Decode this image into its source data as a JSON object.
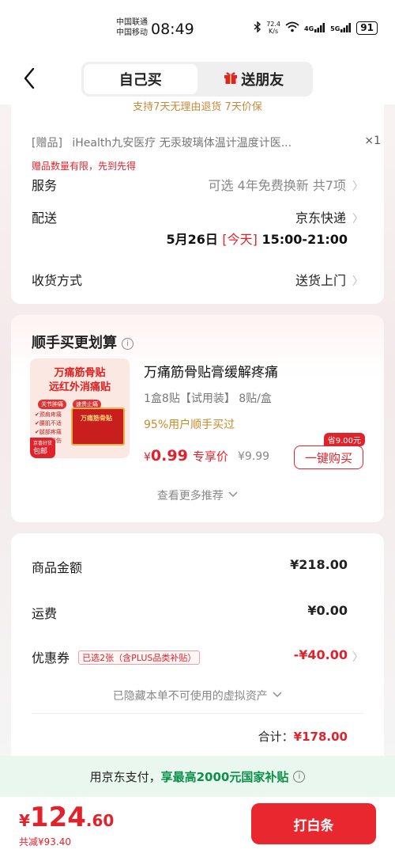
{
  "status_bar": {
    "carrier1": "中国联通",
    "carrier2": "中国移动",
    "time": "08:49",
    "net_speed": "72.4",
    "net_unit": "K/s",
    "signal1": "4G",
    "signal2": "5G",
    "battery": "91"
  },
  "header": {
    "tab_self": "自己买",
    "tab_gift": "送朋友"
  },
  "order": {
    "cut_text": "支持7天无理由退货 7天价保",
    "gift_label": "[赠品]",
    "gift_name": "iHealth九安医疗 无汞玻璃体温计温度计医...",
    "gift_qty": "×1",
    "gift_note": "赠品数量有限，先到先得",
    "service_label": "服务",
    "service_value": "可选 4年免费换新 共7项",
    "delivery_label": "配送",
    "delivery_value": "京东快递",
    "delivery_date": "5月26日",
    "delivery_today": "[今天]",
    "delivery_time": "15:00-21:00",
    "receive_label": "收货方式",
    "receive_value": "送货上门"
  },
  "addon": {
    "title": "顺手买更划算",
    "image": {
      "title_line1": "万痛筋骨贴",
      "title_line2": "远红外消痛贴",
      "tag1": "关节肿痛",
      "tag2": "速贵止痛",
      "list": [
        "颈肩疼痛",
        "腰肌不适",
        "腿部疼痛",
        "肌肉损伤"
      ],
      "box_label": "万痛筋骨贴",
      "badge_top": "京喜好货",
      "badge_main": "包邮"
    },
    "name": "万痛筋骨贴膏缓解疼痛",
    "spec": "1盒8贴【试用装】 8贴/盒",
    "stat": "95%用户顺手买过",
    "price_yen": "¥",
    "price": "0.99",
    "price_label": "专享价",
    "orig_price": "¥9.99",
    "save_tag": "省9.00元",
    "buy_button": "一键购买",
    "more": "查看更多推荐"
  },
  "summary": {
    "goods_label": "商品金额",
    "goods_amount": "¥218.00",
    "freight_label": "运费",
    "freight_amount": "¥0.00",
    "coupon_label": "优惠券",
    "coupon_tag": "已选2张（含PLUS品类补贴）",
    "coupon_amount": "-¥40.00",
    "hidden_assets": "已隐藏本单不可使用的虚拟资产",
    "total_label": "合计：",
    "total_amount": "¥178.00"
  },
  "promo": {
    "prefix": "用京东支付，",
    "highlight": "享最高2000元国家补贴"
  },
  "bottom": {
    "yen": "¥",
    "price_int": "124",
    "price_dec": ".60",
    "saved": "共减¥93.40",
    "pay_button": "打白条"
  },
  "colors": {
    "accent_red": "#e0232b",
    "promo_green": "#0c8f4a"
  }
}
